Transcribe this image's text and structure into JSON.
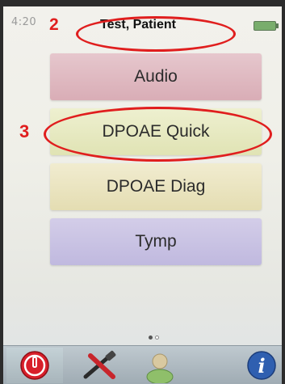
{
  "status_bar": {
    "time": "4:20",
    "patient_name": "Test, Patient"
  },
  "menu": {
    "items": [
      {
        "label": "Audio"
      },
      {
        "label": "DPOAE Quick"
      },
      {
        "label": "DPOAE Diag"
      },
      {
        "label": "Tymp"
      }
    ]
  },
  "annotations": {
    "marker_2": "2",
    "marker_3": "3"
  },
  "pagination": {
    "current_page": 1,
    "total_pages": 2
  },
  "toolbar": {
    "icons": [
      "power-icon",
      "tools-icon",
      "person-icon",
      "info-icon"
    ]
  },
  "colors": {
    "annotation_red": "#e01e1e",
    "audio_button": "#e0bac2",
    "dpoae_quick_button": "#e8eac3",
    "dpoae_diag_button": "#ebe4c2",
    "tymp_button": "#cac3e4",
    "battery_green": "#79ad6c"
  }
}
